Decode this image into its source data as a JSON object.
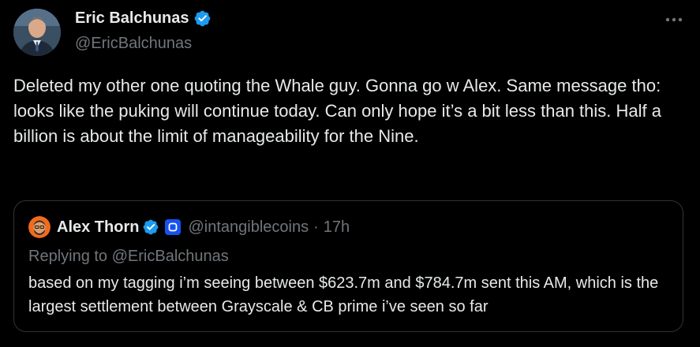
{
  "author": {
    "name": "Eric Balchunas",
    "handle": "@EricBalchunas",
    "verified": true,
    "avatar": "profile-photo"
  },
  "more_icon": "more-horizontal-icon",
  "tweet": {
    "text": "Deleted my other one quoting the Whale guy. Gonna go w Alex. Same message tho: looks like the puking will continue today. Can only hope it’s a bit less than this. Half a billion is about the limit of manageability for the Nine."
  },
  "quote": {
    "author_name": "Alex Thorn",
    "verified": true,
    "affiliate_badge": "affiliate-badge-icon",
    "handle": "@intangiblecoins",
    "separator": "·",
    "time": "17h",
    "replying_to": "Replying to @EricBalchunas",
    "text": "based on my tagging i’m seeing between $623.7m and $784.7m sent this AM, which is the largest settlement between Grayscale & CB prime i’ve seen so far"
  },
  "colors": {
    "background": "#000000",
    "text_primary": "#e7e9ea",
    "text_secondary": "#71767b",
    "verified_blue": "#1d9bf0",
    "affiliate_blue": "#1652f0",
    "border": "#2f3336"
  }
}
